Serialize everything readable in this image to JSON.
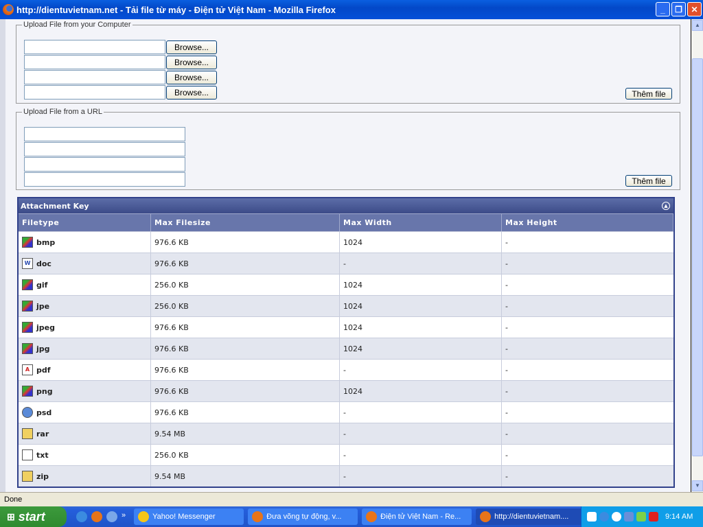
{
  "window": {
    "title": "http://dientuvietnam.net - Tải file từ máy - Điện tử Việt Nam - Mozilla Firefox"
  },
  "upload_computer": {
    "legend": "Upload File from your Computer",
    "browse_label": "Browse...",
    "add_label": "Thêm file"
  },
  "upload_url": {
    "legend": "Upload File from a URL",
    "add_label": "Thêm file"
  },
  "attachment_key": {
    "title": "Attachment Key",
    "headers": [
      "Filetype",
      "Max Filesize",
      "Max Width",
      "Max Height"
    ],
    "rows": [
      {
        "type": "bmp",
        "icon": "image-icon",
        "size": "976.6 KB",
        "width": "1024",
        "height": "-"
      },
      {
        "type": "doc",
        "icon": "word-icon",
        "size": "976.6 KB",
        "width": "-",
        "height": "-"
      },
      {
        "type": "gif",
        "icon": "image-icon",
        "size": "256.0 KB",
        "width": "1024",
        "height": "-"
      },
      {
        "type": "jpe",
        "icon": "image-icon",
        "size": "256.0 KB",
        "width": "1024",
        "height": "-"
      },
      {
        "type": "jpeg",
        "icon": "image-icon",
        "size": "976.6 KB",
        "width": "1024",
        "height": "-"
      },
      {
        "type": "jpg",
        "icon": "image-icon",
        "size": "976.6 KB",
        "width": "1024",
        "height": "-"
      },
      {
        "type": "pdf",
        "icon": "pdf-icon",
        "size": "976.6 KB",
        "width": "-",
        "height": "-"
      },
      {
        "type": "png",
        "icon": "image-icon",
        "size": "976.6 KB",
        "width": "1024",
        "height": "-"
      },
      {
        "type": "psd",
        "icon": "psd-icon",
        "size": "976.6 KB",
        "width": "-",
        "height": "-"
      },
      {
        "type": "rar",
        "icon": "archive-icon",
        "size": "9.54 MB",
        "width": "-",
        "height": "-"
      },
      {
        "type": "txt",
        "icon": "text-file-icon",
        "size": "256.0 KB",
        "width": "-",
        "height": "-"
      },
      {
        "type": "zip",
        "icon": "archive-icon",
        "size": "9.54 MB",
        "width": "-",
        "height": "-"
      }
    ]
  },
  "status": "Done",
  "taskbar": {
    "start": "start",
    "tasks": [
      "Yahoo! Messenger",
      "Đưa võng tự động, v...",
      "Điện tử Việt Nam - Re...",
      "http://dientuvietnam...."
    ],
    "clock": "9:14 AM"
  }
}
